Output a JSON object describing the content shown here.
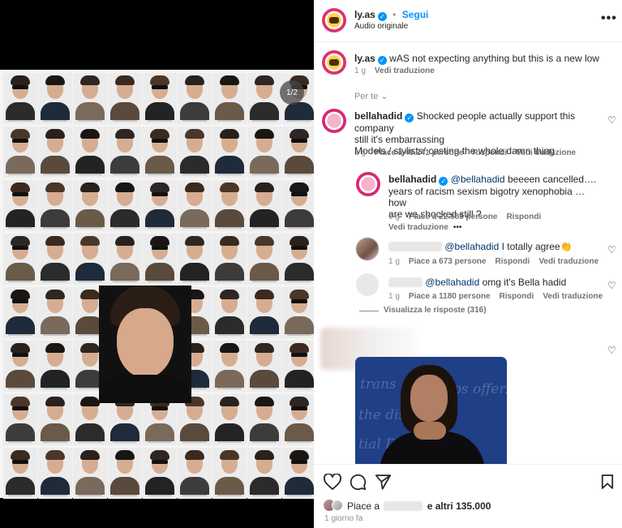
{
  "media": {
    "counter": "1/2",
    "grid_rows": 8,
    "grid_cols": 9
  },
  "header": {
    "username": "ly.as",
    "separator": "•",
    "follow": "Segui",
    "audio": "Audio originale",
    "more_icon": "more-horizontal-icon"
  },
  "caption": {
    "username": "ly.as",
    "text": "wAS not expecting anything but this is a new low",
    "time": "1 g",
    "translate": "Vedi traduzione",
    "per_te": "Per te"
  },
  "comments": [
    {
      "username": "bellahadid",
      "text_lines": [
        "Shocked people actually support this company",
        "still it's embarrassing",
        "Models / stylists/ casting the whole damn thing"
      ],
      "time": "1 g",
      "likes": "Piace a 49.241 persone",
      "reply": "Rispondi",
      "translate": "Vedi traduzione"
    }
  ],
  "replies": [
    {
      "username": "bellahadid",
      "mention": "@bellahadid",
      "text_lines": [
        "beeeen cancelled….",
        "years of racism sexism bigotry xenophobia … how",
        "are we shocked still ?"
      ],
      "time": "1 g",
      "likes": "Piace a 22.885 persone",
      "reply": "Rispondi",
      "translate": "Vedi traduzione",
      "more": "•••"
    },
    {
      "mention": "@bellahadid",
      "text": "I totally agree👏",
      "time": "1 g",
      "likes": "Piace a 673 persone",
      "reply": "Rispondi",
      "translate": "Vedi traduzione"
    },
    {
      "mention": "@bellahadid",
      "text": "omg it's Bella hadid",
      "time": "1 g",
      "likes": "Piace a 1180 persone",
      "reply": "Rispondi",
      "translate": "Vedi traduzione"
    }
  ],
  "view_replies": "Visualizza le risposte (316)",
  "image_text": [
    "trans",
    "the disyl",
    "tial Debates",
    "ps offer."
  ],
  "footer": {
    "likes_prefix": "Piace a",
    "likes_suffix": "e altri 135.000",
    "date": "1 giorno fa"
  },
  "icons": [
    "heart-icon",
    "comment-icon",
    "share-icon",
    "bookmark-icon"
  ],
  "colors": {
    "verified": "#0095f6",
    "link": "#00376b",
    "muted": "#8e8e8e"
  }
}
